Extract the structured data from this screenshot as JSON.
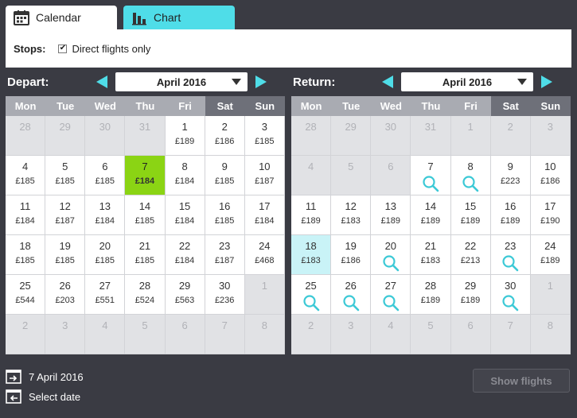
{
  "tabs": [
    {
      "label": "Calendar",
      "icon": "calendar-icon",
      "active": true
    },
    {
      "label": "Chart",
      "icon": "bar-chart-icon",
      "active": false
    }
  ],
  "filters": {
    "stops_label": "Stops:",
    "direct_label": "Direct flights only",
    "direct_checked": true
  },
  "weekdays": [
    "Mon",
    "Tue",
    "Wed",
    "Thu",
    "Fri",
    "Sat",
    "Sun"
  ],
  "depart": {
    "title": "Depart:",
    "month": "April 2016",
    "cells": [
      {
        "d": "28",
        "s": "off"
      },
      {
        "d": "29",
        "s": "off"
      },
      {
        "d": "30",
        "s": "off"
      },
      {
        "d": "31",
        "s": "off"
      },
      {
        "d": "1",
        "p": "£189"
      },
      {
        "d": "2",
        "p": "£186"
      },
      {
        "d": "3",
        "p": "£185"
      },
      {
        "d": "4",
        "p": "£185"
      },
      {
        "d": "5",
        "p": "£185"
      },
      {
        "d": "6",
        "p": "£185"
      },
      {
        "d": "7",
        "p": "£184",
        "s": "sel"
      },
      {
        "d": "8",
        "p": "£184"
      },
      {
        "d": "9",
        "p": "£185"
      },
      {
        "d": "10",
        "p": "£187"
      },
      {
        "d": "11",
        "p": "£184"
      },
      {
        "d": "12",
        "p": "£187"
      },
      {
        "d": "13",
        "p": "£184"
      },
      {
        "d": "14",
        "p": "£185"
      },
      {
        "d": "15",
        "p": "£184"
      },
      {
        "d": "16",
        "p": "£185"
      },
      {
        "d": "17",
        "p": "£184"
      },
      {
        "d": "18",
        "p": "£185"
      },
      {
        "d": "19",
        "p": "£185"
      },
      {
        "d": "20",
        "p": "£185"
      },
      {
        "d": "21",
        "p": "£185"
      },
      {
        "d": "22",
        "p": "£184"
      },
      {
        "d": "23",
        "p": "£187"
      },
      {
        "d": "24",
        "p": "£468"
      },
      {
        "d": "25",
        "p": "£544"
      },
      {
        "d": "26",
        "p": "£203"
      },
      {
        "d": "27",
        "p": "£551"
      },
      {
        "d": "28",
        "p": "£524"
      },
      {
        "d": "29",
        "p": "£563"
      },
      {
        "d": "30",
        "p": "£236"
      },
      {
        "d": "1",
        "s": "off"
      },
      {
        "d": "2",
        "s": "off"
      },
      {
        "d": "3",
        "s": "off"
      },
      {
        "d": "4",
        "s": "off"
      },
      {
        "d": "5",
        "s": "off"
      },
      {
        "d": "6",
        "s": "off"
      },
      {
        "d": "7",
        "s": "off"
      },
      {
        "d": "8",
        "s": "off"
      }
    ]
  },
  "return": {
    "title": "Return:",
    "month": "April 2016",
    "cells": [
      {
        "d": "28",
        "s": "off"
      },
      {
        "d": "29",
        "s": "off"
      },
      {
        "d": "30",
        "s": "off"
      },
      {
        "d": "31",
        "s": "off"
      },
      {
        "d": "1",
        "s": "off"
      },
      {
        "d": "2",
        "s": "off"
      },
      {
        "d": "3",
        "s": "off"
      },
      {
        "d": "4",
        "s": "off"
      },
      {
        "d": "5",
        "s": "off"
      },
      {
        "d": "6",
        "s": "off"
      },
      {
        "d": "7",
        "search": true
      },
      {
        "d": "8",
        "search": true
      },
      {
        "d": "9",
        "p": "£223"
      },
      {
        "d": "10",
        "p": "£186"
      },
      {
        "d": "11",
        "p": "£189"
      },
      {
        "d": "12",
        "p": "£183"
      },
      {
        "d": "13",
        "p": "£189"
      },
      {
        "d": "14",
        "p": "£189"
      },
      {
        "d": "15",
        "p": "£189"
      },
      {
        "d": "16",
        "p": "£189"
      },
      {
        "d": "17",
        "p": "£190"
      },
      {
        "d": "18",
        "p": "£183",
        "s": "hl"
      },
      {
        "d": "19",
        "p": "£186"
      },
      {
        "d": "20",
        "search": true
      },
      {
        "d": "21",
        "p": "£183"
      },
      {
        "d": "22",
        "p": "£213"
      },
      {
        "d": "23",
        "search": true
      },
      {
        "d": "24",
        "p": "£189"
      },
      {
        "d": "25",
        "search": true
      },
      {
        "d": "26",
        "search": true
      },
      {
        "d": "27",
        "search": true
      },
      {
        "d": "28",
        "p": "£189"
      },
      {
        "d": "29",
        "p": "£189"
      },
      {
        "d": "30",
        "search": true
      },
      {
        "d": "1",
        "s": "off"
      },
      {
        "d": "2",
        "s": "off"
      },
      {
        "d": "3",
        "s": "off"
      },
      {
        "d": "4",
        "s": "off"
      },
      {
        "d": "5",
        "s": "off"
      },
      {
        "d": "6",
        "s": "off"
      },
      {
        "d": "7",
        "s": "off"
      },
      {
        "d": "8",
        "s": "off"
      }
    ]
  },
  "footer": {
    "depart_date": "7 April 2016",
    "return_date": "Select date",
    "show_flights": "Show flights"
  },
  "colors": {
    "accent": "#4fdde8",
    "selected": "#8bd414",
    "highlight": "#c9f3f7",
    "background": "#3a3b43"
  }
}
